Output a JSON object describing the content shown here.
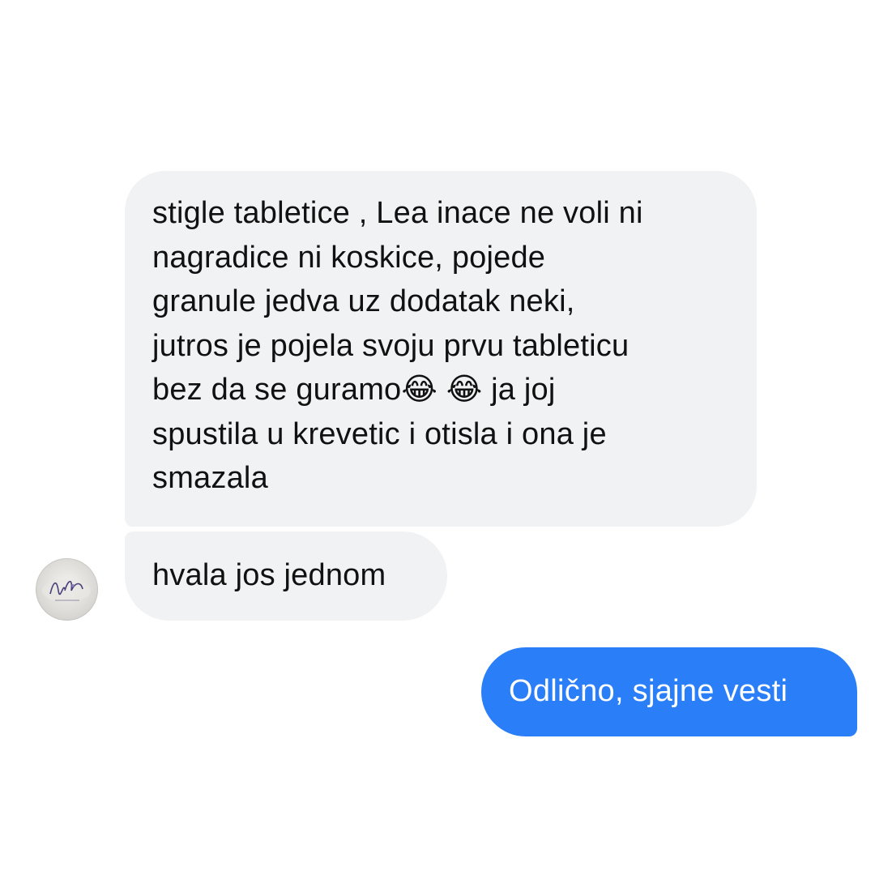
{
  "conversation": {
    "messages": [
      {
        "direction": "incoming",
        "text": "stigle tabletice , Lea inace ne voli ni\nnagradice ni koskice, pojede\ngranule jedva uz dodatak neki,\njutros je pojela svoju prvu tableticu\nbez da se guramo😂 😂  ja joj\nspustila u krevetic i otisla i ona je\nsmazala"
      },
      {
        "direction": "incoming",
        "text": "hvala jos jednom"
      },
      {
        "direction": "outgoing",
        "text": "Odlično, sjajne vesti"
      }
    ],
    "contact_avatar_icon": "contact-avatar-logo"
  },
  "colors": {
    "incoming_bubble": "#f1f2f4",
    "outgoing_bubble": "#2a7ff9",
    "outgoing_text": "#ffffff"
  }
}
